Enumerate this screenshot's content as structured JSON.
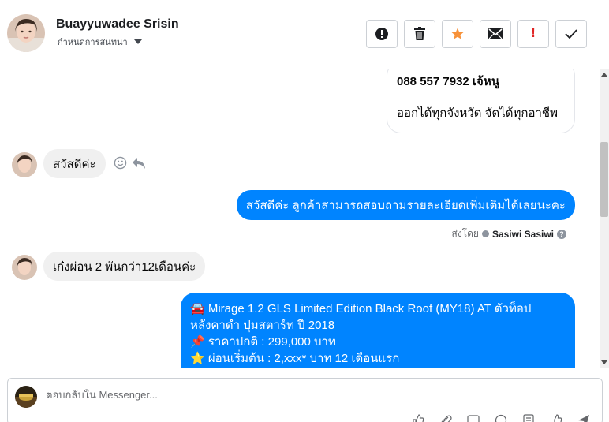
{
  "header": {
    "contact_name": "Buayyuwadee Srisin",
    "assign_label": "กำหนดการสนทนา"
  },
  "actions": {
    "icons": [
      "alert-icon",
      "trash-icon",
      "star-icon",
      "envelope-icon",
      "exclamation-icon",
      "check-icon"
    ],
    "star_color": "#f7923a",
    "exclaim_color": "#e02424",
    "exclaim_text": "!"
  },
  "thread": {
    "card": {
      "line1": "088 557 7932 เจ้หนู",
      "line2": "ออกได้ทุกจังหวัด จัดได้ทุกอาชีพ"
    },
    "incoming1": "สวัสดีค่ะ",
    "outgoing1": "สวัสดีค่ะ ลูกค้าสามารถสอบถามรายละเอียดเพิ่มเติมได้เลยนะคะ",
    "sent_by_prefix": "ส่งโดย",
    "sent_by_name": "Sasiwi Sasiwi",
    "help_char": "?",
    "incoming2": "เก๋งผ่อน 2 พันกว่า12เดือนค่ะ",
    "product": {
      "line1_icon": "🚘",
      "line1": "Mirage 1.2 GLS Limited Edition Black Roof (MY18) AT ตัวท็อป",
      "line2": "หลังคาดำ ปุ่มสตาร์ท ปี 2018",
      "line3_icon": "📌",
      "line3": "ราคาปกติ : 299,000 บาท",
      "line4_icon": "⭐",
      "line4": "ผ่อนเริ่มต้น : 2,xxx* บาท 12 เดือนแรก"
    }
  },
  "composer": {
    "placeholder": "ตอบกลับใน Messenger..."
  },
  "colors": {
    "accent": "#0084ff",
    "incoming_bg": "#f0f0f0"
  }
}
